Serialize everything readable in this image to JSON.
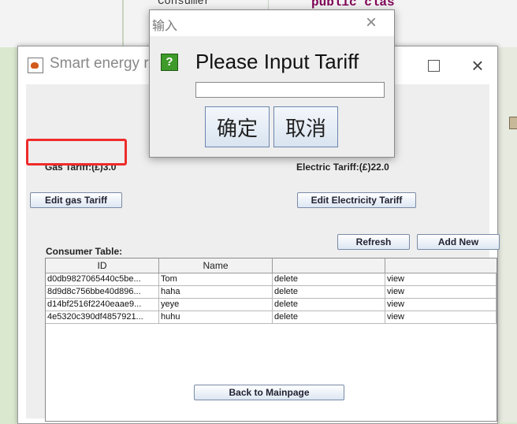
{
  "background": {
    "code_left": "Consumer",
    "code_right": "public clas"
  },
  "window": {
    "title": "Smart energy r",
    "maximize_icon": "maximize-icon",
    "close_glyph": "×"
  },
  "gas": {
    "tariff_label": "Gas Tariff:(£)3.0",
    "edit_button": "Edit gas Tariff"
  },
  "electric": {
    "tariff_label": "Electric Tariff:(£)22.0",
    "edit_button": "Edit Electricity Tariff"
  },
  "table": {
    "title": "Consumer Table:",
    "refresh_button": "Refresh",
    "add_button": "Add New",
    "columns": [
      "ID",
      "Name",
      "",
      ""
    ],
    "rows": [
      [
        "d0db9827065440c5be...",
        "Tom",
        "delete",
        "view"
      ],
      [
        "8d9d8c756bbe40d896...",
        "haha",
        "delete",
        "view"
      ],
      [
        "d14bf2516f2240eaae9...",
        "yeye",
        "delete",
        "view"
      ],
      [
        "4e5320c390df4857921...",
        "huhu",
        "delete",
        "view"
      ]
    ]
  },
  "back_button": "Back to Mainpage",
  "dialog": {
    "title": "输入",
    "close_glyph": "×",
    "question_glyph": "?",
    "message": "Please Input Tariff",
    "input_value": "",
    "ok_button": "确定",
    "cancel_button": "取消"
  },
  "colors": {
    "highlight": "#ef2b2b",
    "question_icon": "#3e9a2a"
  }
}
